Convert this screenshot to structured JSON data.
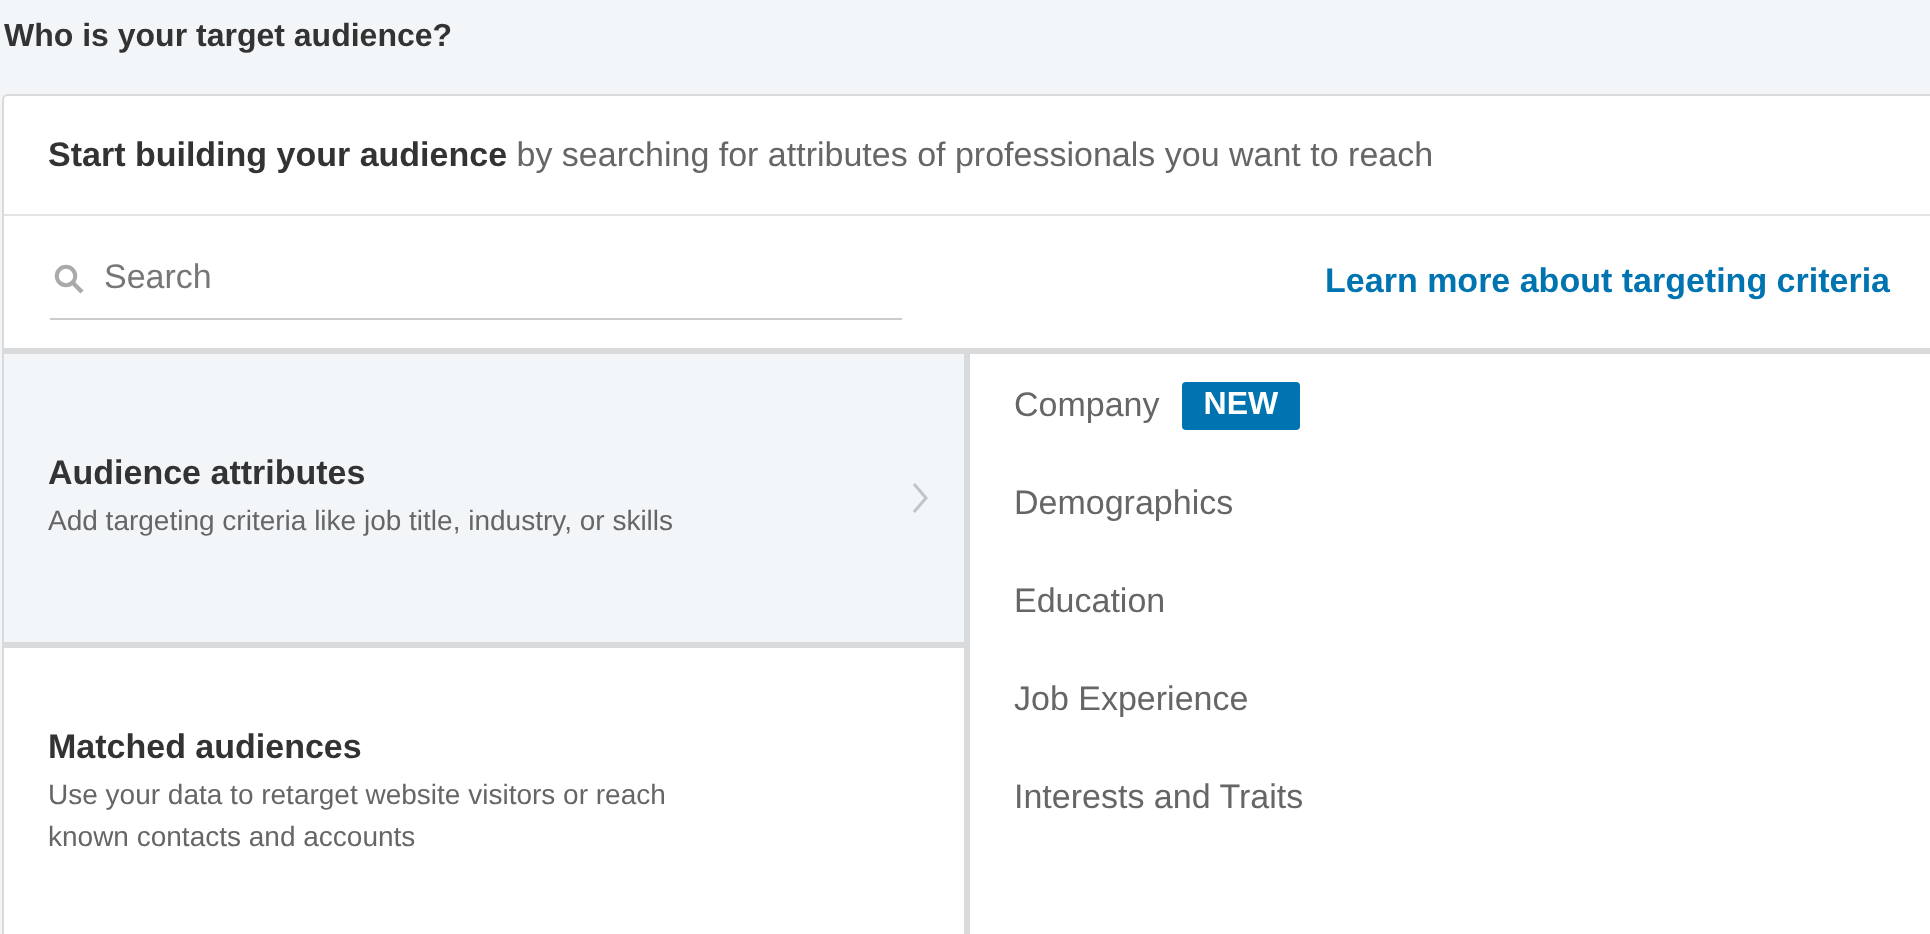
{
  "heading": "Who is your target audience?",
  "intro": {
    "bold": "Start building your audience",
    "rest": "by searching for attributes of professionals you want to reach"
  },
  "search": {
    "placeholder": "Search"
  },
  "learn_link": "Learn more about targeting criteria",
  "categories": [
    {
      "title": "Audience attributes",
      "description": "Add targeting criteria like job title, industry, or skills",
      "selected": true
    },
    {
      "title": "Matched audiences",
      "description": "Use your data to retarget website visitors or reach known contacts and accounts",
      "selected": false
    }
  ],
  "attributes": [
    {
      "label": "Company",
      "badge": "NEW"
    },
    {
      "label": "Demographics"
    },
    {
      "label": "Education"
    },
    {
      "label": "Job Experience"
    },
    {
      "label": "Interests and Traits"
    }
  ]
}
